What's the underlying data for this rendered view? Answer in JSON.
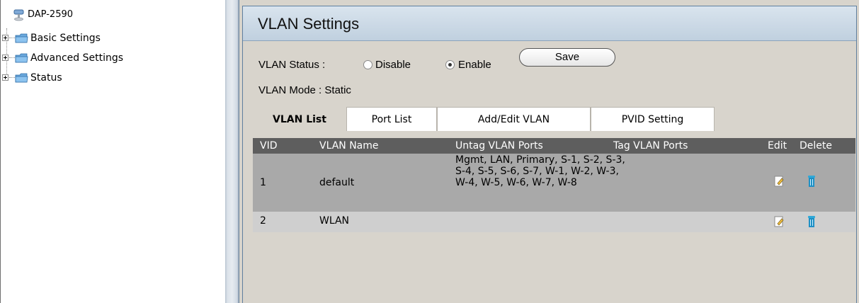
{
  "tree": {
    "root_label": "DAP-2590",
    "nodes": [
      {
        "label": "Basic Settings"
      },
      {
        "label": "Advanced Settings"
      },
      {
        "label": "Status"
      }
    ]
  },
  "page": {
    "title": "VLAN Settings"
  },
  "vlan_status": {
    "label": "VLAN Status :",
    "options": [
      "Disable",
      "Enable"
    ],
    "selected": "Enable"
  },
  "save_label": "Save",
  "vlan_mode": {
    "label": "VLAN Mode :",
    "value": "Static"
  },
  "tabs": [
    {
      "label": "VLAN List",
      "active": true
    },
    {
      "label": "Port List",
      "active": false
    },
    {
      "label": "Add/Edit VLAN",
      "active": false
    },
    {
      "label": "PVID Setting",
      "active": false
    }
  ],
  "table": {
    "headers": {
      "vid": "VID",
      "name": "VLAN Name",
      "untag": "Untag VLAN Ports",
      "tag": "Tag VLAN Ports",
      "edit": "Edit",
      "delete": "Delete"
    },
    "rows": [
      {
        "vid": "1",
        "name": "default",
        "untag": "Mgmt, LAN, Primary, S-1, S-2, S-3, S-4, S-5, S-6, S-7, W-1, W-2, W-3, W-4, W-5, W-6, W-7, W-8",
        "tag": ""
      },
      {
        "vid": "2",
        "name": "WLAN",
        "untag": "",
        "tag": ""
      }
    ]
  },
  "colors": {
    "panel_bg": "#d8d4cc",
    "table_header_bg": "#5e5e5e",
    "row_bg": "#a9a9a9",
    "row_alt_bg": "#cfcfcf",
    "title_bar": "#c8d6e4"
  },
  "icons": {
    "edit": "edit-icon",
    "delete": "trash-icon",
    "folder": "folder-icon",
    "device": "access-point-icon"
  }
}
